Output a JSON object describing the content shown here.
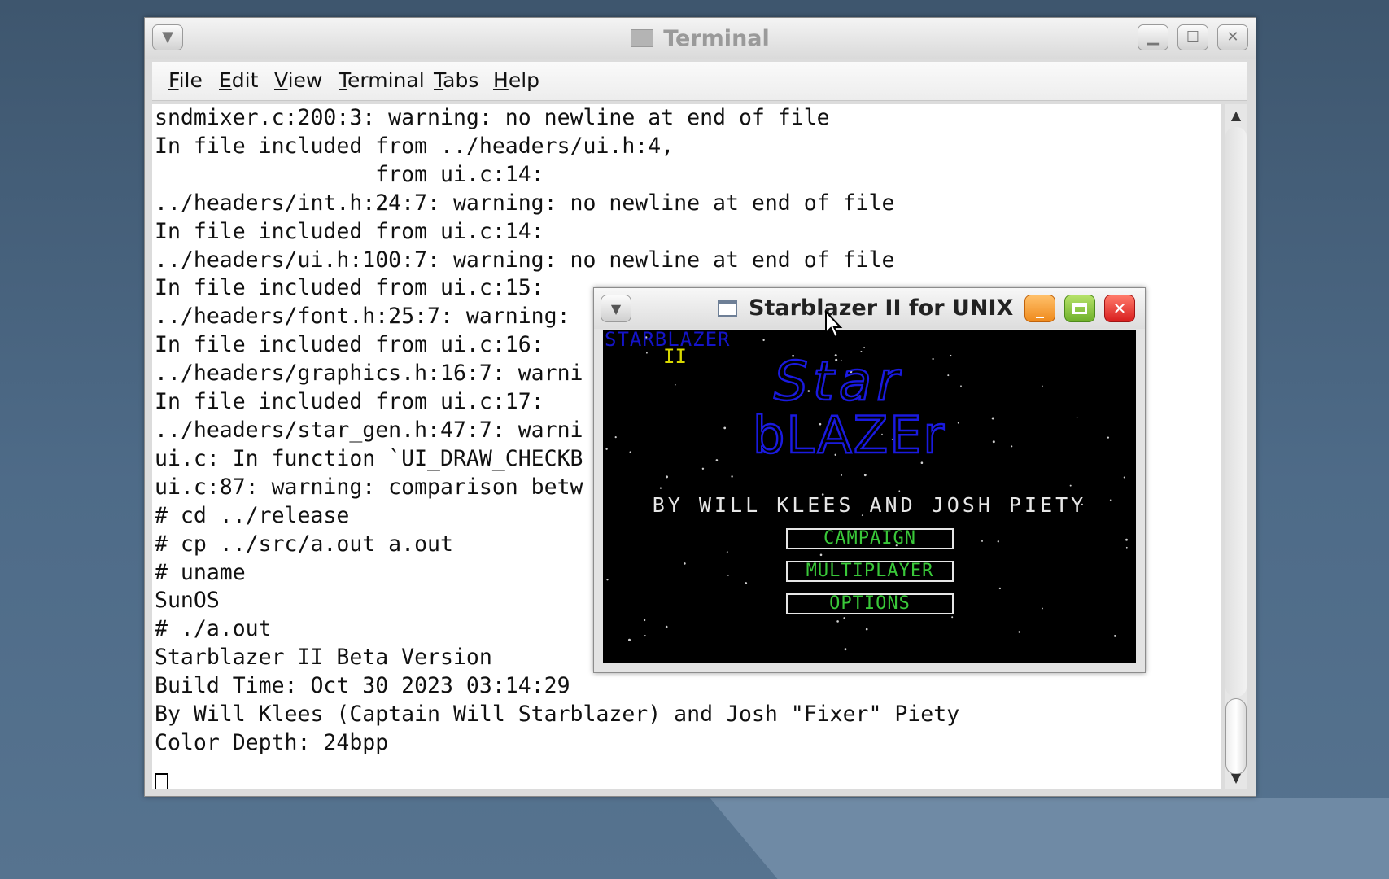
{
  "terminal": {
    "title": "Terminal",
    "menu": [
      "File",
      "Edit",
      "View",
      "Terminal",
      "Tabs",
      "Help"
    ],
    "lines": [
      "sndmixer.c:200:3: warning: no newline at end of file",
      "In file included from ../headers/ui.h:4,",
      "                 from ui.c:14:",
      "../headers/int.h:24:7: warning: no newline at end of file",
      "In file included from ui.c:14:",
      "../headers/ui.h:100:7: warning: no newline at end of file",
      "In file included from ui.c:15:",
      "../headers/font.h:25:7: warning: ",
      "In file included from ui.c:16:",
      "../headers/graphics.h:16:7: warni",
      "In file included from ui.c:17:",
      "../headers/star_gen.h:47:7: warni",
      "ui.c: In function `UI_DRAW_CHECKB",
      "ui.c:87: warning: comparison betw",
      "# cd ../release",
      "# cp ../src/a.out a.out",
      "# uname",
      "SunOS",
      "# ./a.out",
      "Starblazer II Beta Version",
      "Build Time: Oct 30 2023 03:14:29",
      "By Will Klees (Captain Will Starblazer) and Josh \"Fixer\" Piety",
      "Color Depth: 24bpp"
    ]
  },
  "game": {
    "title": "Starblazer II for UNIX",
    "small_logo": "STARBLAZER",
    "small_logo_sub": "II",
    "big_logo_top": "Star",
    "big_logo_bottom": "bLAZEr",
    "credits": "BY WILL KLEES AND JOSH PIETY",
    "buttons": [
      "CAMPAIGN",
      "MULTIPLAYER",
      "OPTIONS"
    ],
    "colors": {
      "logo": "#1414c8",
      "subtitle": "#d8d800",
      "button_text": "#39c839"
    }
  }
}
